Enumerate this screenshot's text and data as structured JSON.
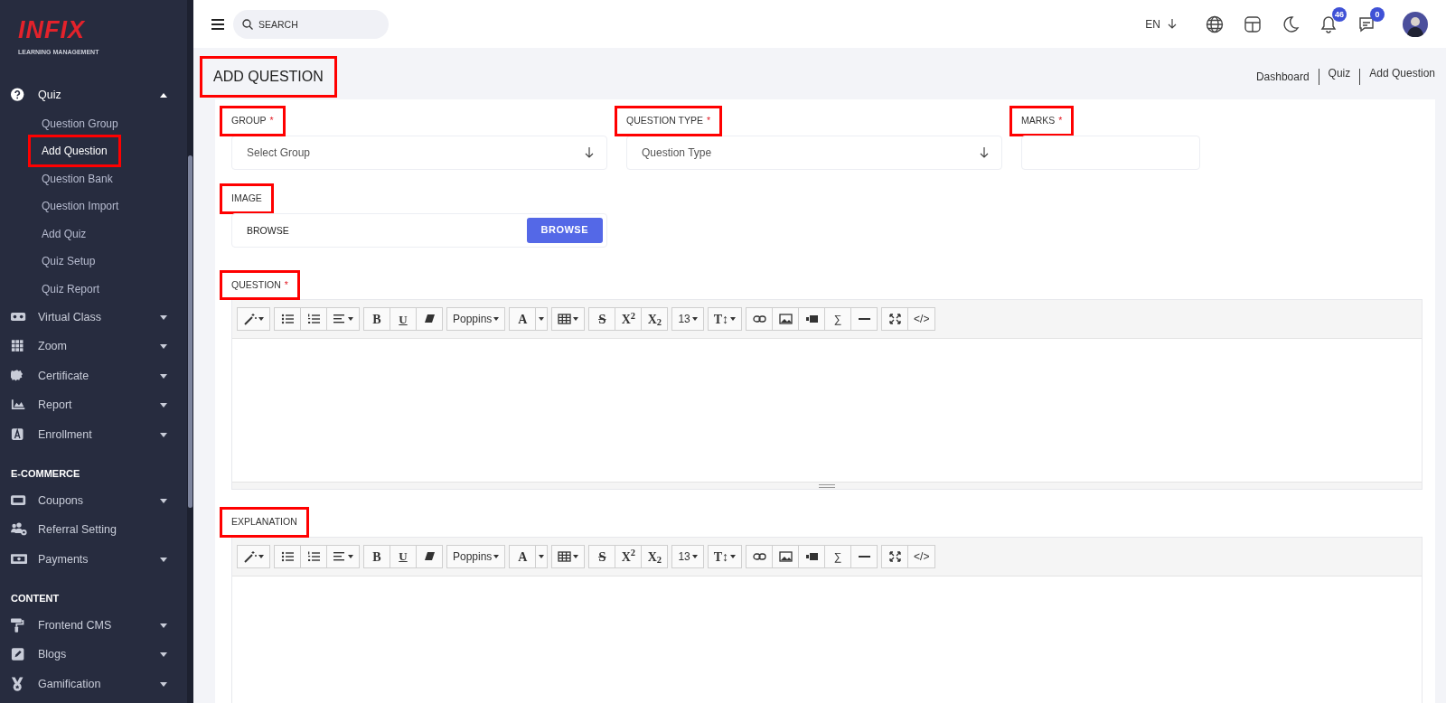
{
  "logo": {
    "name": "INFIX",
    "tagline": "LEARNING MANAGEMENT"
  },
  "sidebar": {
    "sections": [
      {
        "items": [
          {
            "label": "Quiz",
            "expanded": true,
            "children": [
              {
                "label": "Question Group",
                "selected": false
              },
              {
                "label": "Add Question",
                "selected": true,
                "highlighted": true
              },
              {
                "label": "Question Bank",
                "selected": false
              },
              {
                "label": "Question Import",
                "selected": false
              },
              {
                "label": "Add Quiz",
                "selected": false
              },
              {
                "label": "Quiz Setup",
                "selected": false
              },
              {
                "label": "Quiz Report",
                "selected": false
              }
            ]
          },
          {
            "label": "Virtual Class",
            "expanded": false
          },
          {
            "label": "Zoom",
            "expanded": false
          },
          {
            "label": "Certificate",
            "expanded": false
          },
          {
            "label": "Report",
            "expanded": false
          },
          {
            "label": "Enrollment",
            "expanded": false
          }
        ]
      },
      {
        "title": "E-COMMERCE",
        "items": [
          {
            "label": "Coupons",
            "expanded": false
          },
          {
            "label": "Referral Setting"
          },
          {
            "label": "Payments",
            "expanded": false
          }
        ]
      },
      {
        "title": "CONTENT",
        "items": [
          {
            "label": "Frontend CMS",
            "expanded": false
          },
          {
            "label": "Blogs",
            "expanded": false
          },
          {
            "label": "Gamification",
            "expanded": false
          }
        ]
      }
    ]
  },
  "topbar": {
    "search": {
      "placeholder": "SEARCH"
    },
    "language": "EN",
    "notifications": "46",
    "messages": "0"
  },
  "page": {
    "title": "ADD QUESTION",
    "highlighted": true,
    "breadcrumb": [
      "Dashboard",
      "Quiz",
      "Add Question"
    ]
  },
  "fields": [
    {
      "label": "GROUP",
      "required_mark": "*",
      "highlighted": true,
      "kind": "select",
      "placeholder": "Select Group"
    },
    {
      "label": "QUESTION TYPE",
      "required_mark": "*",
      "highlighted": true,
      "kind": "select",
      "placeholder": "Question Type"
    },
    {
      "label": "MARKS",
      "required_mark": "*",
      "highlighted": true,
      "kind": "text"
    }
  ],
  "image": {
    "label": "IMAGE",
    "highlighted": true,
    "placeholder": "BROWSE",
    "button": "BROWSE"
  },
  "editors": [
    {
      "label": "QUESTION",
      "required_mark": "*",
      "highlighted": true,
      "toolbar": [
        [
          {
            "kind": "wand",
            "caret": true
          }
        ],
        [
          {
            "kind": "bullets"
          },
          {
            "kind": "numbers"
          },
          {
            "kind": "align",
            "caret": true
          }
        ],
        [
          {
            "kind": "bold",
            "label": "B"
          },
          {
            "kind": "underline",
            "label": "U"
          },
          {
            "kind": "eraser"
          }
        ],
        [
          {
            "kind": "text",
            "label": "Poppins",
            "caret": true
          }
        ],
        [
          {
            "kind": "serif",
            "label": "A"
          },
          {
            "kind": "split"
          }
        ],
        [
          {
            "kind": "table",
            "caret": true
          }
        ],
        [
          {
            "kind": "strike",
            "label": "S"
          },
          {
            "kind": "serif",
            "label": "X$^{2}$"
          },
          {
            "kind": "serif",
            "label": "X$_{2}$"
          }
        ],
        [
          {
            "kind": "text",
            "label": "13",
            "caret": true
          }
        ],
        [
          {
            "kind": "serif",
            "label": "T↕",
            "caret": true
          }
        ],
        [
          {
            "kind": "link"
          },
          {
            "kind": "picture"
          },
          {
            "kind": "video"
          },
          {
            "kind": "text",
            "label": "∑"
          },
          {
            "kind": "rule"
          }
        ],
        [
          {
            "kind": "expand"
          },
          {
            "kind": "text",
            "label": "</>"
          }
        ]
      ]
    },
    {
      "label": "EXPLANATION",
      "highlighted": true,
      "toolbar": [
        [
          {
            "kind": "wand",
            "caret": true
          }
        ],
        [
          {
            "kind": "bullets"
          },
          {
            "kind": "numbers"
          },
          {
            "kind": "align",
            "caret": true
          }
        ],
        [
          {
            "kind": "bold",
            "label": "B"
          },
          {
            "kind": "underline",
            "label": "U"
          },
          {
            "kind": "eraser"
          }
        ],
        [
          {
            "kind": "text",
            "label": "Poppins",
            "caret": true
          }
        ],
        [
          {
            "kind": "serif",
            "label": "A"
          },
          {
            "kind": "split"
          }
        ],
        [
          {
            "kind": "table",
            "caret": true
          }
        ],
        [
          {
            "kind": "strike",
            "label": "S"
          },
          {
            "kind": "serif",
            "label": "X$^{2}$"
          },
          {
            "kind": "serif",
            "label": "X$_{2}$"
          }
        ],
        [
          {
            "kind": "text",
            "label": "13",
            "caret": true
          }
        ],
        [
          {
            "kind": "serif",
            "label": "T↕",
            "caret": true
          }
        ],
        [
          {
            "kind": "link"
          },
          {
            "kind": "picture"
          },
          {
            "kind": "video"
          },
          {
            "kind": "text",
            "label": "∑"
          },
          {
            "kind": "rule"
          }
        ],
        [
          {
            "kind": "expand"
          },
          {
            "kind": "text",
            "label": "</>"
          }
        ]
      ]
    }
  ]
}
